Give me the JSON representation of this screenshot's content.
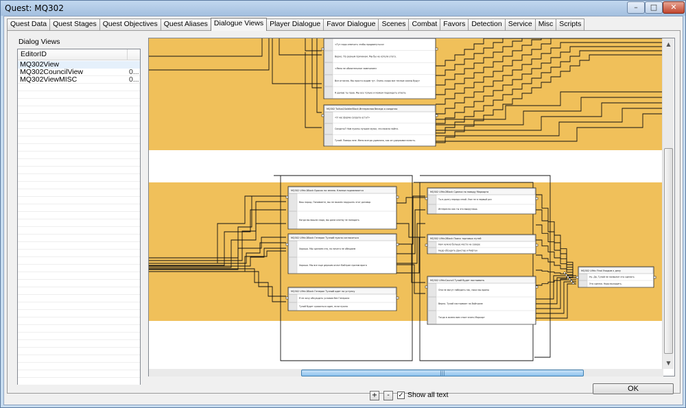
{
  "window": {
    "title": "Quest: MQ302",
    "minimize": "–",
    "maximize": "□",
    "close": "✕"
  },
  "tabs": [
    {
      "label": "Quest Data",
      "active": false
    },
    {
      "label": "Quest Stages",
      "active": false
    },
    {
      "label": "Quest Objectives",
      "active": false
    },
    {
      "label": "Quest Aliases",
      "active": false
    },
    {
      "label": "Dialogue Views",
      "active": true
    },
    {
      "label": "Player Dialogue",
      "active": false
    },
    {
      "label": "Favor Dialogue",
      "active": false
    },
    {
      "label": "Scenes",
      "active": false
    },
    {
      "label": "Combat",
      "active": false
    },
    {
      "label": "Favors",
      "active": false
    },
    {
      "label": "Detection",
      "active": false
    },
    {
      "label": "Service",
      "active": false
    },
    {
      "label": "Misc",
      "active": false
    },
    {
      "label": "Scripts",
      "active": false
    }
  ],
  "dialog_views": {
    "group_label": "Dialog Views",
    "column_header": "EditorID",
    "rows": [
      {
        "editor_id": "MQ302View",
        "extra": ""
      },
      {
        "editor_id": "MQ302CouncilView",
        "extra": "0..."
      },
      {
        "editor_id": "MQ302ViewMISC",
        "extra": "0..."
      }
    ]
  },
  "canvas": {
    "band_color": "#f0c05a",
    "nodes": [
      {
        "title": "",
        "lines": [
          "<Тут надо отвечать чтобы продвинуться>",
          "Верно. По разным причинам. Мы бы не хотели этого.",
          "<Явно не обязательное замечание>",
          "Все отлично. Мы просто сидим тут. Очень скоро все тесные союзы будут",
          "Я думаю ты прав. Мы все только и можем подождать ответа."
        ]
      },
      {
        "title": "MQ302 Tullius1SoldierBlock Интересная беседа о солдатах",
        "lines": [
          "<У нас форма солдата есть?>",
          "Солдаты? Нам нужны лучшие мужи, что можно найти.",
          "Тулий. Поверь мне. Меня всегда удивляло, как он удерживал власть."
        ]
      },
      {
        "title": "MQ302 Ulfric1Block Бросок на землю. Клинки поднимаются",
        "lines": [
          "Ваш народ. Понимаете, мы не можем нарушить этот договор",
          "Когда вы вошли сюда, мы дали клятву не нападать"
        ]
      },
      {
        "title": "MQ302 Ulfric1Block Генерал Туллий нужно согласиться",
        "lines": [
          "Хорошо. Мы сделаем это, но ничего не обещаем",
          "Хорошо. Мы все еще держим оплот Вайтран против врага"
        ]
      },
      {
        "title": "MQ302 Ulfric1Block Генерал Туллий идет на уступку",
        "lines": [
          "Я не хочу обсуждать условия без Генерала",
          "Тулий будет сражаться один, если нужно"
        ]
      },
      {
        "title": "MQ302 Ulfric2Block Сделка по поводу Маркарта",
        "lines": [
          "Ты в долгу передо мной. Уже не в первый раз",
          "Интересно как ты это выкрутишь"
        ]
      },
      {
        "title": "MQ302 Ulfric2Block Поиск торговых путей",
        "lines": [
          "Нам нужно больше места на севере",
          "Надо обсудить Данстар и Рифтен"
        ]
      },
      {
        "title": "MQ302 UlfricCouncil Тулий будет настаивать",
        "lines": [
          "Они не могут победить нас, пока мы едины",
          "Верно. Тулий настаивает на Вайтране",
          "Тогда в жизни вам стоит взять Маркарт"
        ]
      },
      {
        "title": "MQ302 Ulfric Final Уходим к делу",
        "lines": [
          "Ну. Да, Тулий не позволит это сделать",
          "Это сделка. Надо выходить."
        ]
      }
    ]
  },
  "scroll": {
    "h_grip": "|||"
  },
  "controls": {
    "zoom_in": "+",
    "zoom_out": "-",
    "show_all_text_label": "Show all text",
    "show_all_text_checked": true,
    "ok_label": "OK"
  }
}
